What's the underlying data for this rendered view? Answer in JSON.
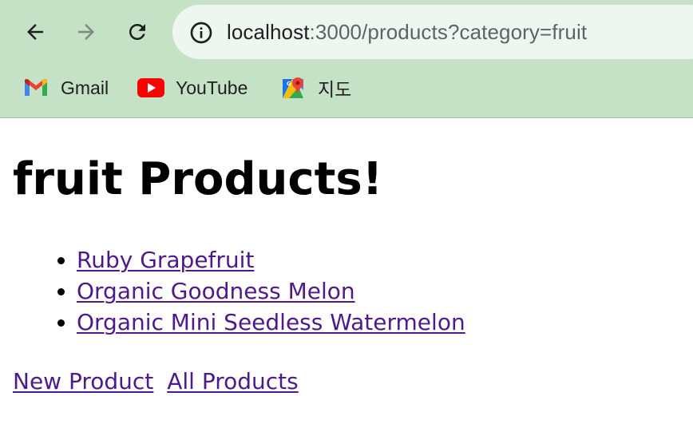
{
  "browser": {
    "url_host": "localhost",
    "url_rest": ":3000/products?category=fruit",
    "bookmarks": [
      {
        "label": "Gmail",
        "icon": "gmail-icon"
      },
      {
        "label": "YouTube",
        "icon": "youtube-icon"
      },
      {
        "label": "지도",
        "icon": "maps-icon"
      }
    ],
    "accent_color": "#c5e2c7"
  },
  "page": {
    "title": "fruit Products!",
    "products": [
      "Ruby Grapefruit",
      "Organic Goodness Melon",
      "Organic Mini Seedless Watermelon"
    ],
    "footer_links": {
      "new_product": "New Product",
      "all_products": "All Products"
    },
    "link_color": "#4e1a8b"
  }
}
